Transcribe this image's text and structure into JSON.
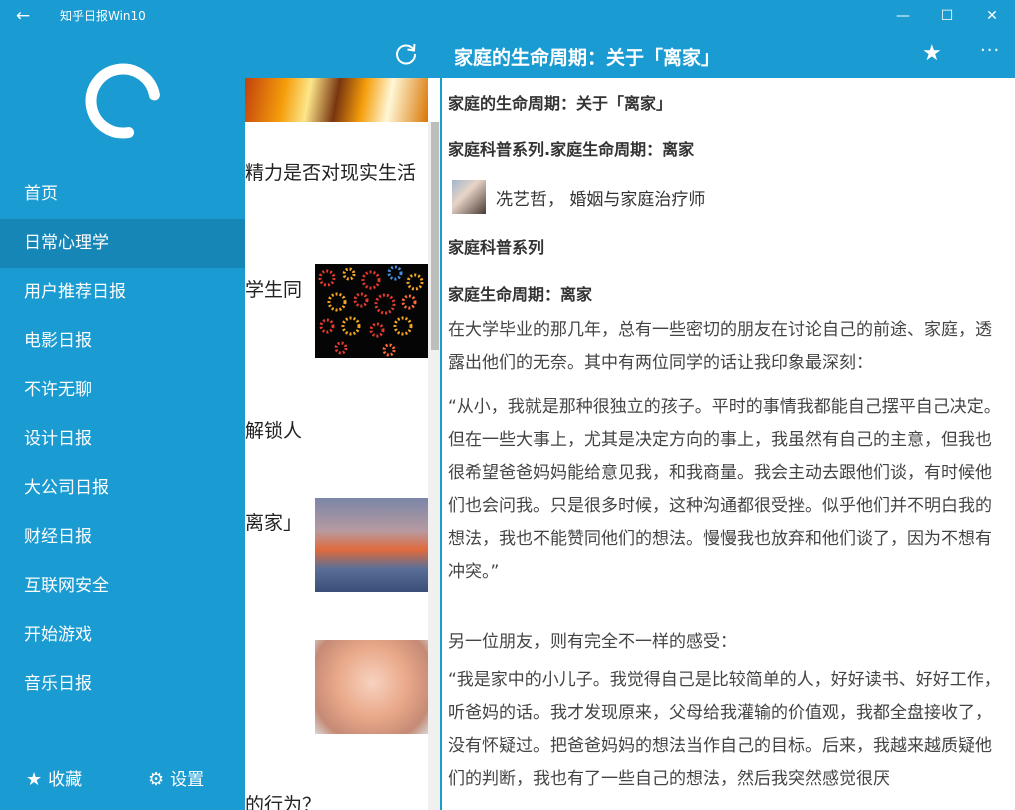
{
  "window": {
    "back_icon": "←",
    "title": "知乎日报Win10",
    "minimize_icon": "—",
    "maximize_icon": "☐",
    "close_icon": "✕"
  },
  "sidebar": {
    "items": [
      {
        "label": "首页"
      },
      {
        "label": "日常心理学",
        "active": true
      },
      {
        "label": "用户推荐日报"
      },
      {
        "label": "电影日报"
      },
      {
        "label": "不许无聊"
      },
      {
        "label": "设计日报"
      },
      {
        "label": "大公司日报"
      },
      {
        "label": "财经日报"
      },
      {
        "label": "互联网安全"
      },
      {
        "label": "开始游戏"
      },
      {
        "label": "音乐日报"
      }
    ],
    "favorites_icon": "★",
    "favorites_label": "收藏",
    "settings_icon": "⚙",
    "settings_label": "设置"
  },
  "list": {
    "items": [
      {
        "text": "精力是否对现实生活"
      },
      {
        "text": "学生同"
      },
      {
        "text": "解锁人"
      },
      {
        "text": "离家」"
      },
      {
        "text": "的行为？"
      }
    ]
  },
  "article": {
    "title": "家庭的生命周期：关于「离家」",
    "star_icon": "★",
    "more_icon": "···",
    "heading1": "家庭的生命周期：关于「离家」",
    "heading2": "家庭科普系列.家庭生命周期：离家",
    "author": "冼艺哲， 婚姻与家庭治疗师",
    "heading3": "家庭科普系列",
    "heading4": "家庭生命周期：离家",
    "para1": "在大学毕业的那几年，总有一些密切的朋友在讨论自己的前途、家庭，透露出他们的无奈。其中有两位同学的话让我印象最深刻：",
    "para2": "“从小，我就是那种很独立的孩子。平时的事情我都能自己摆平自己决定。但在一些大事上，尤其是决定方向的事上，我虽然有自己的主意，但我也很希望爸爸妈妈能给意见我，和我商量。我会主动去跟他们谈，有时候他们也会问我。只是很多时候，这种沟通都很受挫。似乎他们并不明白我的想法，我也不能赞同他们的想法。慢慢我也放弃和他们谈了，因为不想有冲突。”",
    "para3": "另一位朋友，则有完全不一样的感受：",
    "para4": "“我是家中的小儿子。我觉得自己是比较简单的人，好好读书、好好工作，听爸妈的话。我才发现原来，父母给我灌输的价值观，我都全盘接收了，没有怀疑过。把爸爸妈妈的想法当作自己的目标。后来，我越来越质疑他们的判断，我也有了一些自己的想法，然后我突然感觉很厌"
  },
  "colors": {
    "accent": "#1a9bd2",
    "nav_active": "#1686b7"
  }
}
